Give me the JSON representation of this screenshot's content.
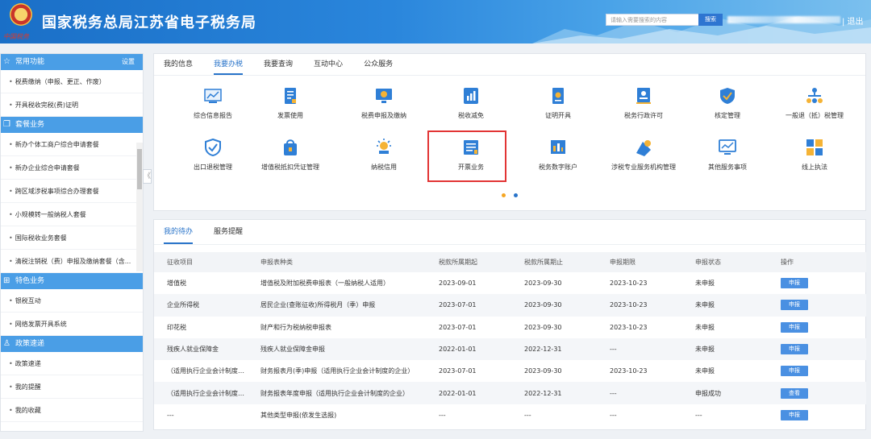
{
  "header": {
    "title": "国家税务总局江苏省电子税务局",
    "emblem_script": "中国税务",
    "search_placeholder": "请输入需要搜索的内容",
    "search_button": "搜索",
    "logout": "| 退出"
  },
  "sidebar": {
    "common": {
      "title": "常用功能",
      "settings": "设置",
      "items": [
        "税费缴纳（申报、更正、作废）",
        "开具税收完税(费)证明"
      ]
    },
    "package": {
      "title": "套餐业务",
      "items": [
        "新办个体工商户综合申请套餐",
        "新办企业综合申请套餐",
        "跨区域涉税事项综合办理套餐",
        "小规模转一般纳税人套餐",
        "国际税收业务套餐",
        "清税注销税（费）申报及缴纳套餐（含..."
      ]
    },
    "special": {
      "title": "特色业务",
      "items": [
        "银税互动",
        "网络发票开具系统"
      ]
    },
    "policy": {
      "title": "政策速递",
      "items": [
        "政策速递",
        "我的提醒",
        "我的收藏"
      ]
    },
    "collapse": "《"
  },
  "main_tabs": [
    "我的信息",
    "我要办税",
    "我要查询",
    "互动中心",
    "公众服务"
  ],
  "functions": [
    {
      "label": "综合信息报告",
      "icon": "chart-report-icon"
    },
    {
      "label": "发票使用",
      "icon": "invoice-icon"
    },
    {
      "label": "税费申报及缴纳",
      "icon": "monitor-icon"
    },
    {
      "label": "税收减免",
      "icon": "tax-reduction-icon"
    },
    {
      "label": "证明开具",
      "icon": "certificate-icon"
    },
    {
      "label": "税务行政许可",
      "icon": "permit-icon"
    },
    {
      "label": "核定管理",
      "icon": "shield-check-icon"
    },
    {
      "label": "一般退（抵）税管理",
      "icon": "org-tree-icon"
    },
    {
      "label": "出口退税管理",
      "icon": "export-shield-icon"
    },
    {
      "label": "增值税抵扣凭证管理",
      "icon": "voucher-icon"
    },
    {
      "label": "纳税信用",
      "icon": "credit-icon"
    },
    {
      "label": "开票业务",
      "icon": "issue-invoice-icon"
    },
    {
      "label": "税务数字账户",
      "icon": "digital-account-icon"
    },
    {
      "label": "涉税专业服务机构管理",
      "icon": "agency-icon"
    },
    {
      "label": "其他服务事项",
      "icon": "other-service-icon"
    },
    {
      "label": "线上执法",
      "icon": "online-law-icon"
    }
  ],
  "bottom_tabs": [
    "我的待办",
    "服务提醒"
  ],
  "table": {
    "headers": [
      "征收项目",
      "申报表种类",
      "税款所属期起",
      "税款所属期止",
      "申报期限",
      "申报状态",
      "操作"
    ],
    "rows": [
      [
        "增值税",
        "增值税及附加税费申报表（一般纳税人适用）",
        "2023-09-01",
        "2023-09-30",
        "2023-10-23",
        "未申报",
        "申报"
      ],
      [
        "企业所得税",
        "居民企业(查账征收)所得税月（季）申报",
        "2023-07-01",
        "2023-09-30",
        "2023-10-23",
        "未申报",
        "申报"
      ],
      [
        "印花税",
        "财产和行为税纳税申报表",
        "2023-07-01",
        "2023-09-30",
        "2023-10-23",
        "未申报",
        "申报"
      ],
      [
        "残疾人就业保障金",
        "残疾人就业保障金申报",
        "2022-01-01",
        "2022-12-31",
        "---",
        "未申报",
        "申报"
      ],
      [
        "（适用执行企业会计制度的...",
        "财务报表月(季)申报（适用执行企业会计制度的企业）",
        "2023-07-01",
        "2023-09-30",
        "2023-10-23",
        "未申报",
        "申报"
      ],
      [
        "（适用执行企业会计制度的...",
        "财务报表年度申报（适用执行企业会计制度的企业）",
        "2022-01-01",
        "2022-12-31",
        "---",
        "申报成功",
        "查看"
      ],
      [
        "---",
        "其他类型申报(依发生选报)",
        "---",
        "---",
        "---",
        "---",
        "申报"
      ]
    ]
  },
  "colors": {
    "primary": "#2873c9",
    "sidebar_group": "#4a9ee6",
    "button": "#4a90e2",
    "highlight": "#e23434",
    "pager_active": "#f5a623",
    "pager_inactive": "#2873c9"
  }
}
